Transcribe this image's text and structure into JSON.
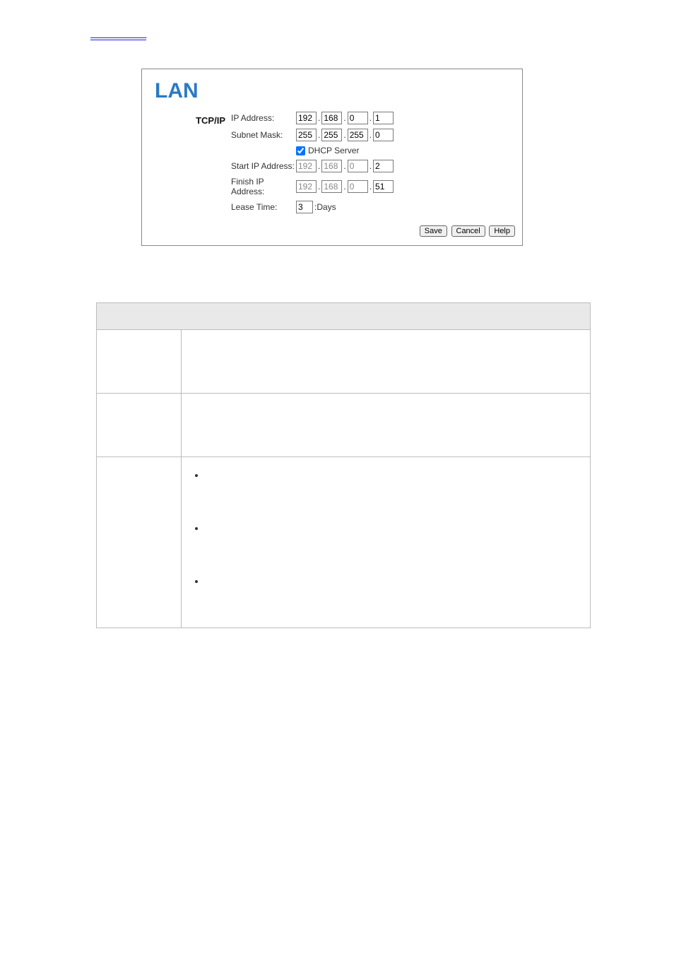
{
  "toplink": {
    "label": ""
  },
  "panel": {
    "title": "LAN",
    "group_label": "TCP/IP",
    "rows": {
      "ip_label": "IP Address:",
      "ip": [
        "192",
        "168",
        "0",
        "1"
      ],
      "mask_label": "Subnet Mask:",
      "mask": [
        "255",
        "255",
        "255",
        "0"
      ],
      "dhcp_label": "DHCP Server",
      "dhcp_checked": true,
      "start_label": "Start IP Address:",
      "start": [
        "192",
        "168",
        "0",
        "2"
      ],
      "finish_label": "Finish IP Address:",
      "finish": [
        "192",
        "168",
        "0",
        "51"
      ],
      "lease_label": "Lease Time:",
      "lease_value": "3",
      "lease_unit": ":Days"
    },
    "buttons": {
      "save": "Save",
      "cancel": "Cancel",
      "help": "Help"
    }
  },
  "table": {
    "header": "",
    "rows": [
      {
        "left": "",
        "right_text": ""
      },
      {
        "left": "",
        "right_text": ""
      }
    ],
    "bullets_left": "",
    "bullets": [
      "",
      "",
      ""
    ]
  }
}
